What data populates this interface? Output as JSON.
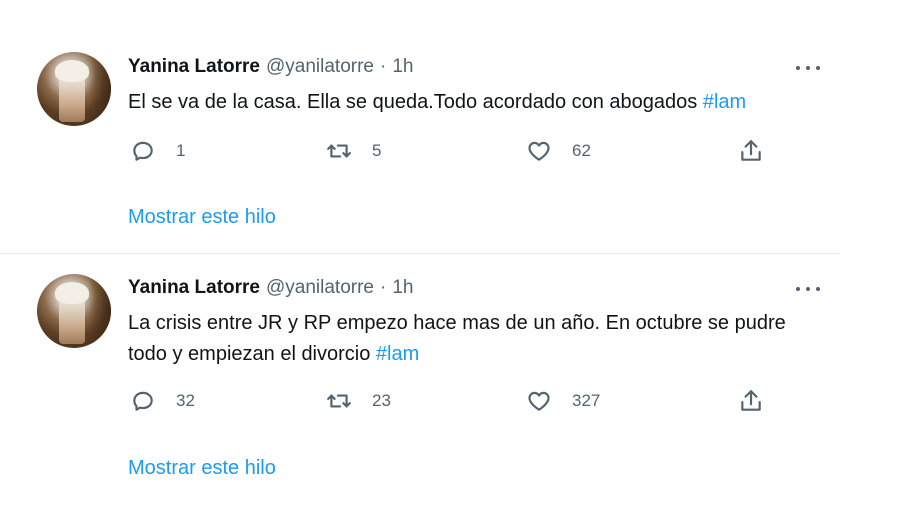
{
  "tweets": [
    {
      "name": "Yanina Latorre",
      "handle": "@yanilatorre",
      "separator": "·",
      "time": "1h",
      "text": "El se va de la casa. Ella se queda.Todo acordado con abogados ",
      "hashtag": "#lam",
      "replies": "1",
      "retweets": "5",
      "likes": "62",
      "thread_link": "Mostrar este hilo"
    },
    {
      "name": "Yanina Latorre",
      "handle": "@yanilatorre",
      "separator": "·",
      "time": "1h",
      "text": "La crisis entre JR y RP empezo hace mas de un año. En octubre se pudre todo y empiezan el divorcio ",
      "hashtag": "#lam",
      "replies": "32",
      "retweets": "23",
      "likes": "327",
      "thread_link": "Mostrar este hilo"
    }
  ],
  "icons": {
    "reply": "reply-icon",
    "retweet": "retweet-icon",
    "like": "heart-icon",
    "share": "share-icon",
    "more": "more-options-icon"
  },
  "colors": {
    "accent": "#1d9bf0",
    "secondary_text": "#536471",
    "primary_text": "#0f1419"
  }
}
